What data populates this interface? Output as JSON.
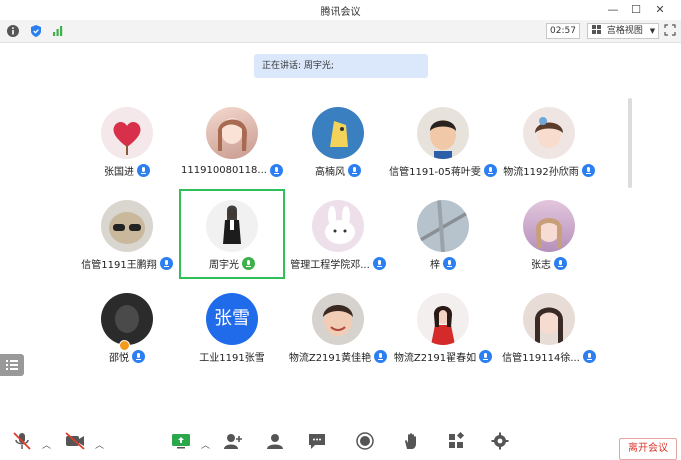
{
  "window": {
    "title": "腾讯会议"
  },
  "statusbar": {
    "timer": "02:57",
    "view_label": "宫格视图"
  },
  "speaking": {
    "text": "正在讲话: 周宇光;"
  },
  "participants": [
    {
      "name": "张国进",
      "mic": "on"
    },
    {
      "name": "111910080118...",
      "mic": "on"
    },
    {
      "name": "高楠风",
      "mic": "on"
    },
    {
      "name": "信管1191-05蒋叶雯",
      "mic": "on"
    },
    {
      "name": "物流1192孙欣雨",
      "mic": "on"
    },
    {
      "name": "信管1191王鹏翔",
      "mic": "on"
    },
    {
      "name": "周宇光",
      "mic": "talking"
    },
    {
      "name": "管理工程学院邓...",
      "mic": "on"
    },
    {
      "name": "梓",
      "mic": "on"
    },
    {
      "name": "张志",
      "mic": "on"
    },
    {
      "name": "邵悦",
      "mic": "on"
    },
    {
      "name": "工业1191张雪",
      "mic": "none",
      "avatar_text": "张雪"
    },
    {
      "name": "物流Z2191黄佳艳",
      "mic": "on"
    },
    {
      "name": "物流Z2191翟春如",
      "mic": "on"
    },
    {
      "name": "信管119114徐...",
      "mic": "on"
    }
  ],
  "toolbar": {
    "leave_label": "离开会议"
  },
  "colors": {
    "accent": "#2c7ff0",
    "talking": "#3db04c",
    "leave": "#d9362b"
  }
}
